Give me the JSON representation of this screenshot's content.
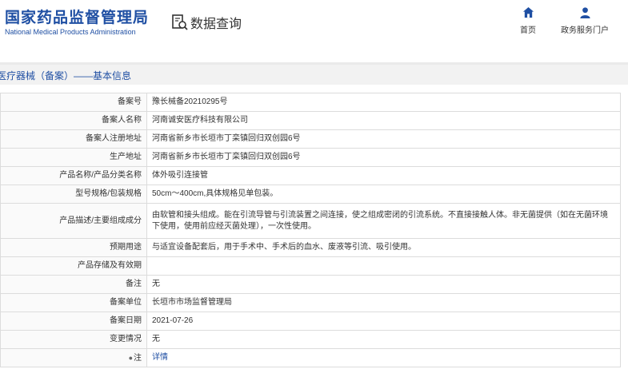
{
  "header": {
    "logo_cn": "国家药品监督管理局",
    "logo_en": "National Medical Products Administration",
    "search_title": "数据查询",
    "nav": [
      {
        "label": "首页",
        "icon": "home-icon"
      },
      {
        "label": "政务服务门户",
        "icon": "user-icon"
      }
    ]
  },
  "breadcrumb": "医疗器械（备案）——基本信息",
  "colors": {
    "brand": "#1f4fa3",
    "label_bg": "#fafafa",
    "border": "#dcdcdc"
  },
  "rows": [
    {
      "label": "备案号",
      "value": "豫长械备20210295号"
    },
    {
      "label": "备案人名称",
      "value": "河南诚安医疗科技有限公司"
    },
    {
      "label": "备案人注册地址",
      "value": "河南省新乡市长垣市丁栾镇回归双创园6号"
    },
    {
      "label": "生产地址",
      "value": "河南省新乡市长垣市丁栾镇回归双创园6号"
    },
    {
      "label": "产品名称/产品分类名称",
      "value": "体外吸引连接管"
    },
    {
      "label": "型号规格/包装规格",
      "value": "50cm～400cm,具体规格见单包装。"
    },
    {
      "label": "产品描述/主要组成成分",
      "value": "由软管和接头组成。能在引流导管与引流装置之间连接，使之组成密闭的引流系统。不直接接触人体。非无菌提供（如在无菌环境下使用，使用前应经灭菌处理），一次性使用。"
    },
    {
      "label": "预期用途",
      "value": "与适宜设备配套后，用于手术中、手术后的血水、废液等引流、吸引使用。"
    },
    {
      "label": "产品存储及有效期",
      "value": ""
    },
    {
      "label": "备注",
      "value": "无"
    },
    {
      "label": "备案单位",
      "value": "长垣市市场监督管理局"
    },
    {
      "label": "备案日期",
      "value": "2021-07-26"
    },
    {
      "label": "变更情况",
      "value": "无"
    },
    {
      "label": "注",
      "value": "详情",
      "icon": "pin-icon"
    }
  ]
}
